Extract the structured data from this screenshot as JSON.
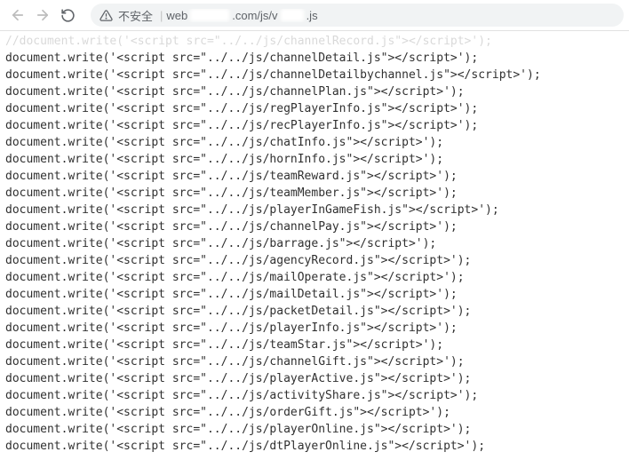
{
  "toolbar": {
    "security_label": "不安全",
    "url_prefix": "web",
    "url_mid": ".com/js/v",
    "url_suffix": ".js"
  },
  "code": {
    "lines": [
      {
        "file": "channelRecord.js",
        "faded": true,
        "commented": true
      },
      {
        "file": "channelDetail.js"
      },
      {
        "file": "channelDetailbychannel.js"
      },
      {
        "file": "channelPlan.js"
      },
      {
        "file": "regPlayerInfo.js"
      },
      {
        "file": "recPlayerInfo.js"
      },
      {
        "file": "chatInfo.js"
      },
      {
        "file": "hornInfo.js"
      },
      {
        "file": "teamReward.js"
      },
      {
        "file": "teamMember.js"
      },
      {
        "file": "playerInGameFish.js"
      },
      {
        "file": "channelPay.js"
      },
      {
        "file": "barrage.js"
      },
      {
        "file": "agencyRecord.js"
      },
      {
        "file": "mailOperate.js"
      },
      {
        "file": "mailDetail.js"
      },
      {
        "file": "packetDetail.js"
      },
      {
        "file": "playerInfo.js"
      },
      {
        "file": "teamStar.js"
      },
      {
        "file": "channelGift.js"
      },
      {
        "file": "playerActive.js"
      },
      {
        "file": "activityShare.js"
      },
      {
        "file": "orderGift.js"
      },
      {
        "file": "playerOnline.js"
      },
      {
        "file": "dtPlayerOnline.js"
      }
    ],
    "prefix_normal": "document.write('<script src=\"../../js/",
    "prefix_comment": "//document.write('<script src=\"../../js/",
    "suffix": "\"></script>');"
  }
}
